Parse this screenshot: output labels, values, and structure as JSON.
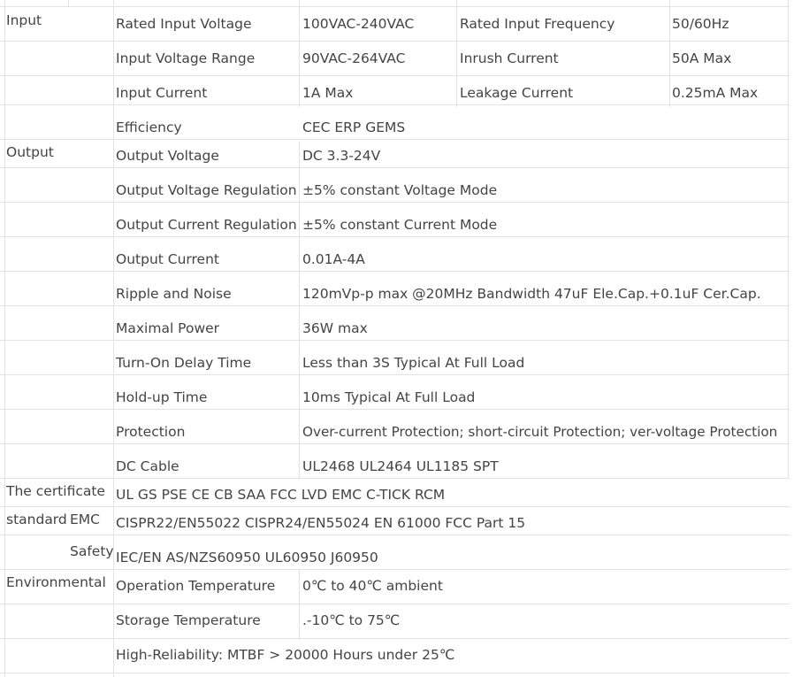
{
  "sections": {
    "input": "Input",
    "output": "Output",
    "certificate": "The certificate",
    "standard": "standard",
    "environmental": "Environmental"
  },
  "input": {
    "rated_input_voltage": {
      "label": "Rated Input Voltage",
      "value": "100VAC-240VAC"
    },
    "rated_input_frequency": {
      "label": "Rated Input Frequency",
      "value": "50/60Hz"
    },
    "input_voltage_range": {
      "label": "Input Voltage Range",
      "value": "90VAC-264VAC"
    },
    "inrush_current": {
      "label": "Inrush Current",
      "value": "50A Max"
    },
    "input_current": {
      "label": "Input Current",
      "value": "1A Max"
    },
    "leakage_current": {
      "label": "Leakage Current",
      "value": "0.25mA Max"
    },
    "efficiency": {
      "label": "Efficiency",
      "value": "CEC ERP GEMS"
    }
  },
  "output": {
    "output_voltage": {
      "label": "Output Voltage",
      "value": "DC 3.3-24V"
    },
    "voltage_regulation": {
      "label": "Output Voltage Regulation",
      "value": "±5% constant Voltage Mode"
    },
    "current_regulation": {
      "label": "Output Current Regulation",
      "value": "±5% constant Current Mode"
    },
    "output_current": {
      "label": "Output Current",
      "value": "0.01A-4A"
    },
    "ripple_noise": {
      "label": "Ripple and Noise",
      "value": "120mVp-p max @20MHz Bandwidth 47uF Ele.Cap.+0.1uF Cer.Cap."
    },
    "maximal_power": {
      "label": "Maximal Power",
      "value": "36W max"
    },
    "turn_on_delay": {
      "label": "Turn-On Delay Time",
      "value": "Less than 3S Typical At Full Load"
    },
    "hold_up_time": {
      "label": "Hold-up Time",
      "value": "10ms Typical At Full Load"
    },
    "protection": {
      "label": "Protection",
      "value": "Over-current Protection; short-circuit Protection; ver-voltage Protection"
    },
    "dc_cable": {
      "label": "DC Cable",
      "value": "UL2468 UL2464 UL1185 SPT"
    }
  },
  "certificate": {
    "list": "UL GS PSE CE CB SAA FCC LVD EMC C-TICK RCM",
    "emc_label": "EMC",
    "emc_value": "CISPR22/EN55022 CISPR24/EN55024 EN 61000  FCC Part 15",
    "safety_label": "Safety",
    "safety_value": "IEC/EN AS/NZS60950 UL60950 J60950"
  },
  "environmental": {
    "operation_temp": {
      "label": "Operation Temperature",
      "value": "0℃ to 40℃ ambient"
    },
    "storage_temp": {
      "label": "Storage Temperature",
      "value": ".-10℃ to 75℃"
    },
    "reliability": "High-Reliability: MTBF > 20000 Hours under 25℃"
  }
}
